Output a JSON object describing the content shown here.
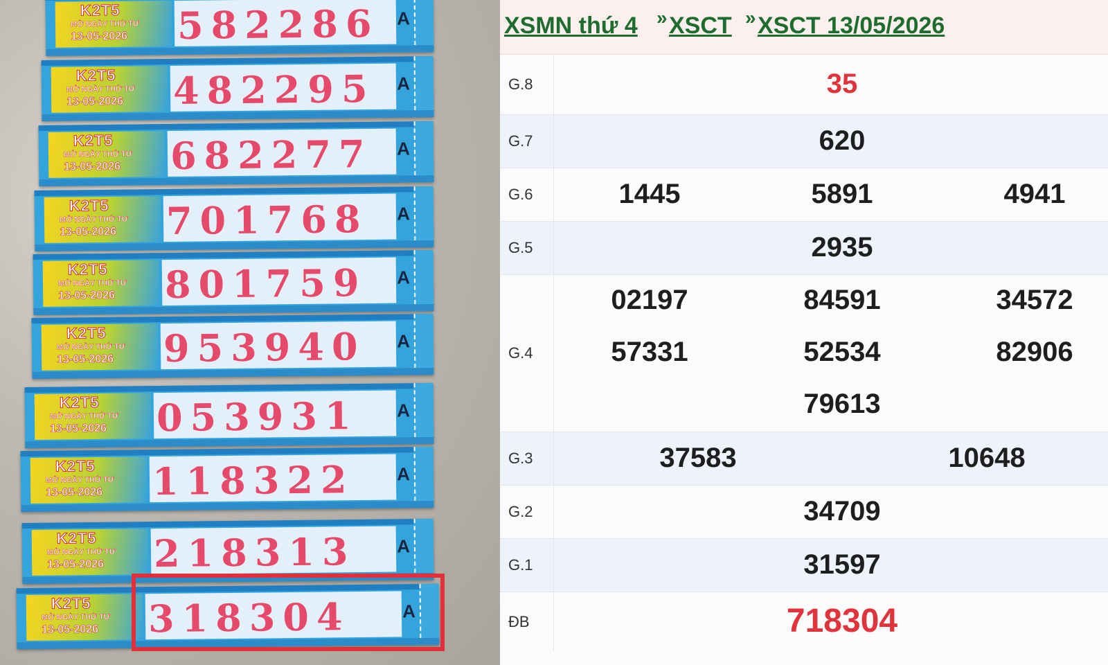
{
  "tickets": [
    {
      "code": "K2T5",
      "sub": "MỞ NGÀY THỨ TƯ",
      "date": "13-05-2026",
      "number": "582286",
      "series": "A"
    },
    {
      "code": "K2T5",
      "sub": "MỞ NGÀY THỨ TƯ",
      "date": "13-05-2026",
      "number": "482295",
      "series": "A"
    },
    {
      "code": "K2T5",
      "sub": "MỞ NGÀY THỨ TƯ",
      "date": "13-05-2026",
      "number": "682277",
      "series": "A"
    },
    {
      "code": "K2T5",
      "sub": "MỞ NGÀY THỨ TƯ",
      "date": "13-05-2026",
      "number": "701768",
      "series": "A"
    },
    {
      "code": "K2T5",
      "sub": "MỞ NGÀY THỨ TƯ",
      "date": "13-05-2026",
      "number": "801759",
      "series": "A"
    },
    {
      "code": "K2T5",
      "sub": "MỞ NGÀY THỨ TƯ",
      "date": "13-05-2026",
      "number": "953940",
      "series": "A"
    },
    {
      "code": "K2T5",
      "sub": "MỞ NGÀY THỨ TƯ",
      "date": "13-05-2026",
      "number": "053931",
      "series": "A"
    },
    {
      "code": "K2T5",
      "sub": "MỞ NGÀY THỨ TƯ",
      "date": "13-05-2026",
      "number": "118322",
      "series": "A"
    },
    {
      "code": "K2T5",
      "sub": "MỞ NGÀY THỨ TƯ",
      "date": "13-05-2026",
      "number": "218313",
      "series": "A"
    },
    {
      "code": "K2T5",
      "sub": "MỞ NGÀY THỨ TƯ",
      "date": "13-05-2026",
      "number": "318304",
      "series": "A"
    }
  ],
  "breadcrumb": {
    "item1": "XSMN thứ 4",
    "sep": "»",
    "item2": "XSCT",
    "item3": "XSCT 13/05/2026"
  },
  "results": {
    "g8": {
      "label": "G.8",
      "values": [
        "35"
      ]
    },
    "g7": {
      "label": "G.7",
      "values": [
        "620"
      ]
    },
    "g6": {
      "label": "G.6",
      "values": [
        "1445",
        "5891",
        "4941"
      ]
    },
    "g5": {
      "label": "G.5",
      "values": [
        "2935"
      ]
    },
    "g4": {
      "label": "G.4",
      "values": [
        "02197",
        "84591",
        "34572",
        "57331",
        "52534",
        "82906",
        "79613"
      ]
    },
    "g3": {
      "label": "G.3",
      "values": [
        "37583",
        "10648"
      ]
    },
    "g2": {
      "label": "G.2",
      "values": [
        "34709"
      ]
    },
    "g1": {
      "label": "G.1",
      "values": [
        "31597"
      ]
    },
    "db": {
      "label": "ĐB",
      "values": [
        "718304"
      ]
    }
  },
  "colors": {
    "highlight_red": "#e0343c",
    "link_green": "#1f6d2e",
    "alt_row": "#eef2fb"
  }
}
